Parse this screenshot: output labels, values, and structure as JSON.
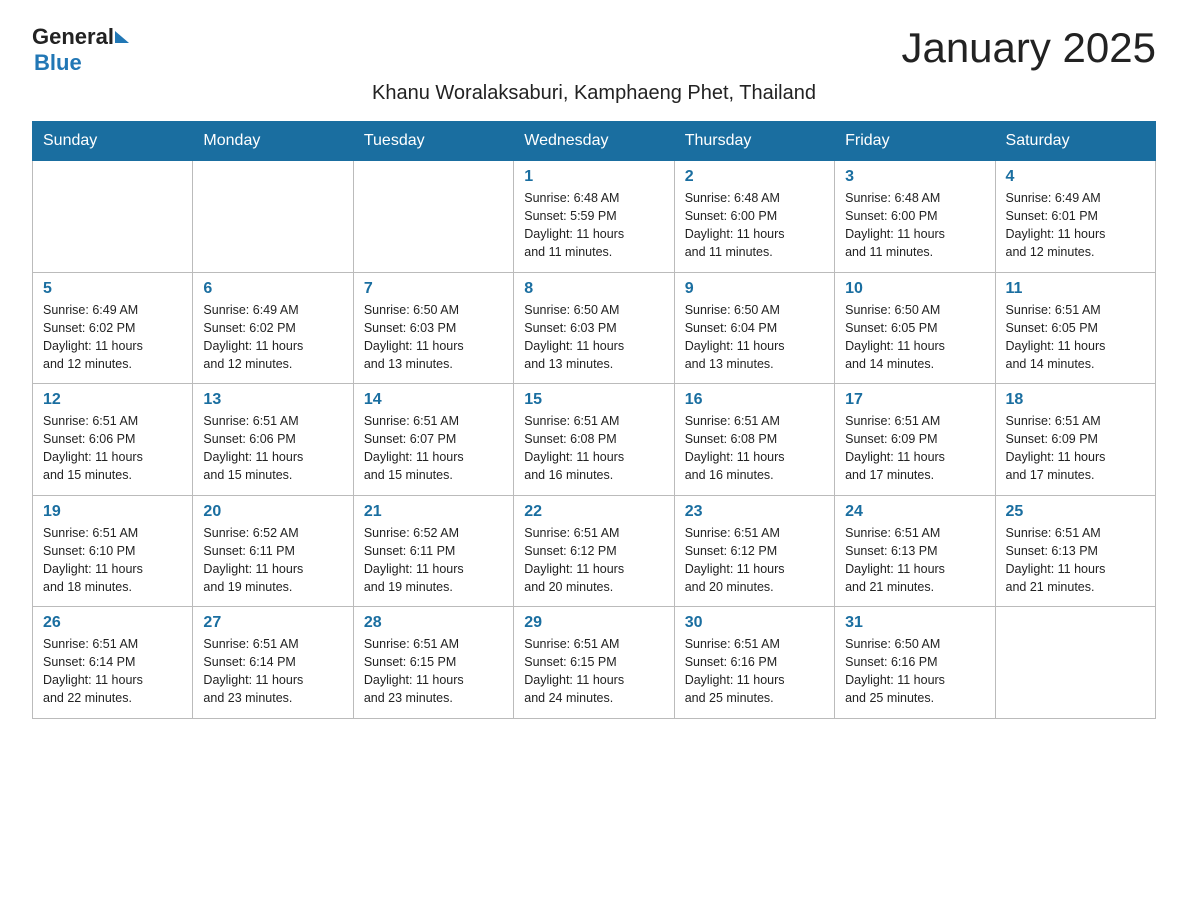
{
  "header": {
    "logo_general": "General",
    "logo_blue": "Blue",
    "month_title": "January 2025",
    "subtitle": "Khanu Woralaksaburi, Kamphaeng Phet, Thailand"
  },
  "days_of_week": [
    "Sunday",
    "Monday",
    "Tuesday",
    "Wednesday",
    "Thursday",
    "Friday",
    "Saturday"
  ],
  "weeks": [
    [
      {
        "day": "",
        "info": ""
      },
      {
        "day": "",
        "info": ""
      },
      {
        "day": "",
        "info": ""
      },
      {
        "day": "1",
        "info": "Sunrise: 6:48 AM\nSunset: 5:59 PM\nDaylight: 11 hours\nand 11 minutes."
      },
      {
        "day": "2",
        "info": "Sunrise: 6:48 AM\nSunset: 6:00 PM\nDaylight: 11 hours\nand 11 minutes."
      },
      {
        "day": "3",
        "info": "Sunrise: 6:48 AM\nSunset: 6:00 PM\nDaylight: 11 hours\nand 11 minutes."
      },
      {
        "day": "4",
        "info": "Sunrise: 6:49 AM\nSunset: 6:01 PM\nDaylight: 11 hours\nand 12 minutes."
      }
    ],
    [
      {
        "day": "5",
        "info": "Sunrise: 6:49 AM\nSunset: 6:02 PM\nDaylight: 11 hours\nand 12 minutes."
      },
      {
        "day": "6",
        "info": "Sunrise: 6:49 AM\nSunset: 6:02 PM\nDaylight: 11 hours\nand 12 minutes."
      },
      {
        "day": "7",
        "info": "Sunrise: 6:50 AM\nSunset: 6:03 PM\nDaylight: 11 hours\nand 13 minutes."
      },
      {
        "day": "8",
        "info": "Sunrise: 6:50 AM\nSunset: 6:03 PM\nDaylight: 11 hours\nand 13 minutes."
      },
      {
        "day": "9",
        "info": "Sunrise: 6:50 AM\nSunset: 6:04 PM\nDaylight: 11 hours\nand 13 minutes."
      },
      {
        "day": "10",
        "info": "Sunrise: 6:50 AM\nSunset: 6:05 PM\nDaylight: 11 hours\nand 14 minutes."
      },
      {
        "day": "11",
        "info": "Sunrise: 6:51 AM\nSunset: 6:05 PM\nDaylight: 11 hours\nand 14 minutes."
      }
    ],
    [
      {
        "day": "12",
        "info": "Sunrise: 6:51 AM\nSunset: 6:06 PM\nDaylight: 11 hours\nand 15 minutes."
      },
      {
        "day": "13",
        "info": "Sunrise: 6:51 AM\nSunset: 6:06 PM\nDaylight: 11 hours\nand 15 minutes."
      },
      {
        "day": "14",
        "info": "Sunrise: 6:51 AM\nSunset: 6:07 PM\nDaylight: 11 hours\nand 15 minutes."
      },
      {
        "day": "15",
        "info": "Sunrise: 6:51 AM\nSunset: 6:08 PM\nDaylight: 11 hours\nand 16 minutes."
      },
      {
        "day": "16",
        "info": "Sunrise: 6:51 AM\nSunset: 6:08 PM\nDaylight: 11 hours\nand 16 minutes."
      },
      {
        "day": "17",
        "info": "Sunrise: 6:51 AM\nSunset: 6:09 PM\nDaylight: 11 hours\nand 17 minutes."
      },
      {
        "day": "18",
        "info": "Sunrise: 6:51 AM\nSunset: 6:09 PM\nDaylight: 11 hours\nand 17 minutes."
      }
    ],
    [
      {
        "day": "19",
        "info": "Sunrise: 6:51 AM\nSunset: 6:10 PM\nDaylight: 11 hours\nand 18 minutes."
      },
      {
        "day": "20",
        "info": "Sunrise: 6:52 AM\nSunset: 6:11 PM\nDaylight: 11 hours\nand 19 minutes."
      },
      {
        "day": "21",
        "info": "Sunrise: 6:52 AM\nSunset: 6:11 PM\nDaylight: 11 hours\nand 19 minutes."
      },
      {
        "day": "22",
        "info": "Sunrise: 6:51 AM\nSunset: 6:12 PM\nDaylight: 11 hours\nand 20 minutes."
      },
      {
        "day": "23",
        "info": "Sunrise: 6:51 AM\nSunset: 6:12 PM\nDaylight: 11 hours\nand 20 minutes."
      },
      {
        "day": "24",
        "info": "Sunrise: 6:51 AM\nSunset: 6:13 PM\nDaylight: 11 hours\nand 21 minutes."
      },
      {
        "day": "25",
        "info": "Sunrise: 6:51 AM\nSunset: 6:13 PM\nDaylight: 11 hours\nand 21 minutes."
      }
    ],
    [
      {
        "day": "26",
        "info": "Sunrise: 6:51 AM\nSunset: 6:14 PM\nDaylight: 11 hours\nand 22 minutes."
      },
      {
        "day": "27",
        "info": "Sunrise: 6:51 AM\nSunset: 6:14 PM\nDaylight: 11 hours\nand 23 minutes."
      },
      {
        "day": "28",
        "info": "Sunrise: 6:51 AM\nSunset: 6:15 PM\nDaylight: 11 hours\nand 23 minutes."
      },
      {
        "day": "29",
        "info": "Sunrise: 6:51 AM\nSunset: 6:15 PM\nDaylight: 11 hours\nand 24 minutes."
      },
      {
        "day": "30",
        "info": "Sunrise: 6:51 AM\nSunset: 6:16 PM\nDaylight: 11 hours\nand 25 minutes."
      },
      {
        "day": "31",
        "info": "Sunrise: 6:50 AM\nSunset: 6:16 PM\nDaylight: 11 hours\nand 25 minutes."
      },
      {
        "day": "",
        "info": ""
      }
    ]
  ]
}
